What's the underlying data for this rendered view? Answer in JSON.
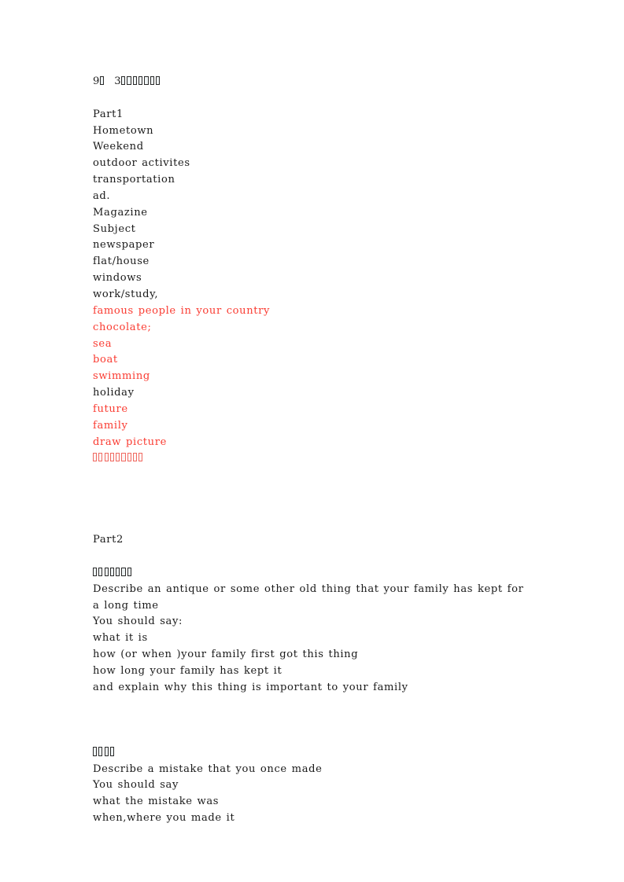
{
  "document": {
    "title_line": {
      "month_number": "9",
      "day_number": "3",
      "month_label_boxes": 1,
      "trailing_label_boxes": 7,
      "note": "CJK characters render as missing-glyph boxes"
    },
    "part1": {
      "heading": "Part1",
      "items": [
        {
          "text": "Hometown",
          "color": "black"
        },
        {
          "text": "Weekend",
          "color": "black"
        },
        {
          "text": "outdoor activites",
          "color": "black"
        },
        {
          "text": "transportation",
          "color": "black"
        },
        {
          "text": "ad.",
          "color": "black"
        },
        {
          "text": "Magazine",
          "color": "black"
        },
        {
          "text": "Subject",
          "color": "black"
        },
        {
          "text": "newspaper",
          "color": "black"
        },
        {
          "text": "flat/house",
          "color": "black"
        },
        {
          "text": "windows",
          "color": "black"
        },
        {
          "text": "work/study,",
          "color": "black"
        },
        {
          "text": "famous people in your country",
          "color": "red"
        },
        {
          "text": "chocolate;",
          "color": "red"
        },
        {
          "text": "sea",
          "color": "red"
        },
        {
          "text": "boat",
          "color": "red"
        },
        {
          "text": "swimming",
          "color": "red"
        },
        {
          "text": "holiday",
          "color": "black"
        },
        {
          "text": "future",
          "color": "red"
        },
        {
          "text": "family",
          "color": "red"
        },
        {
          "text": "draw picture",
          "color": "red"
        }
      ],
      "trailing_boxes": {
        "count": 9,
        "color": "red"
      }
    },
    "part2": {
      "heading": "Part2",
      "topics": [
        {
          "label_boxes": 7,
          "label_color": "black",
          "prompt": "Describe an antique or some other old thing that your family has kept for a long time",
          "instruction": "You should say:",
          "bullets": [
            "what it is",
            "how (or when )your family first got this thing",
            "how long your family has kept it",
            "and explain why this thing is important to your family"
          ]
        },
        {
          "label_boxes": 4,
          "label_color": "black",
          "prompt": "Describe a mistake that you once made",
          "instruction": "You should say",
          "bullets": [
            "what the mistake was",
            "when,where you made it"
          ]
        }
      ]
    },
    "colors": {
      "text": "#1a1a1a",
      "highlight_red": "#fa3c32",
      "page_background": "#ffffff"
    }
  }
}
